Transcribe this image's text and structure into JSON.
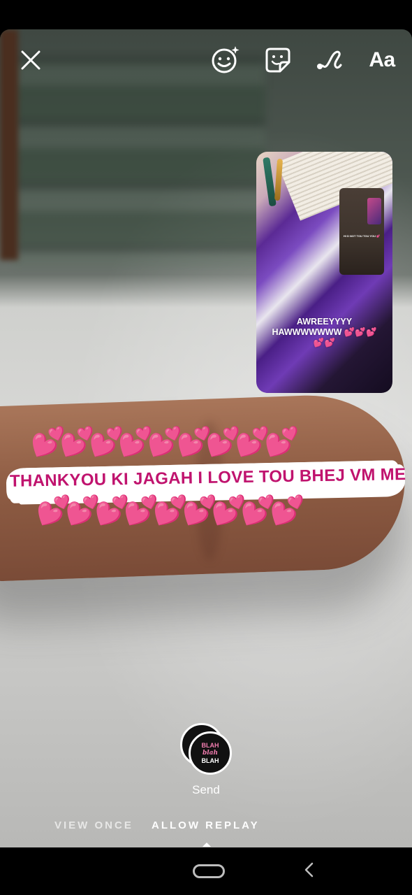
{
  "toolbar": {
    "text_tool_label": "Aa",
    "icons": [
      "close-icon",
      "face-effects-icon",
      "sticker-icon",
      "draw-icon",
      "text-icon"
    ]
  },
  "story_thumbnail": {
    "caption_line1": "AWREEYYYY",
    "caption_line2": "HAWWWWWWW 💕💕💕",
    "caption_line3": "💕💕",
    "inner_caption": "HI D NOT TOU TOU YOU 💕"
  },
  "sticker": {
    "text": "THANKYOU KI JAGAH I LOVE TOU BHEJ VM ME",
    "hearts_top": "💕💕💕💕💕💕💕💕💕",
    "hearts_bottom": "💕💕💕💕💕💕💕💕💕"
  },
  "send": {
    "avatar_line1": "BLAH",
    "avatar_line2": "blah",
    "avatar_line3": "BLAH",
    "label": "Send"
  },
  "replay_options": {
    "view_once": "VIEW ONCE",
    "allow_replay": "ALLOW REPLAY",
    "selected": "allow_replay"
  },
  "colors": {
    "sticker_text": "#c0136e",
    "sticker_band": "#ffffff",
    "background": "#000000"
  }
}
